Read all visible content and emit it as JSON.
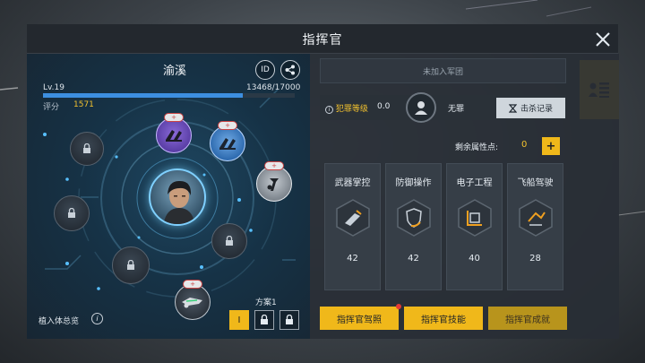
{
  "title": "指挥官",
  "commander": {
    "name": "渝溪",
    "id_label": "ID",
    "level": "Lv.19",
    "xp_text": "13468/17000",
    "xp_ratio": 0.792,
    "score_label": "评分",
    "score": "1571"
  },
  "implants": {
    "overview_label": "植入体总览",
    "info_label": "i",
    "plan_label": "方案1",
    "plan_buttons": [
      "I",
      "🔒",
      "🔒"
    ],
    "slots": [
      {
        "icon": "lock-icon",
        "state": "locked"
      },
      {
        "icon": "ship-parts-icon",
        "state": "purple",
        "badge": "+"
      },
      {
        "icon": "ship-parts-icon",
        "state": "blue",
        "badge": "+"
      },
      {
        "icon": "wrench-icon",
        "state": "gray",
        "badge": "+"
      },
      {
        "icon": "lock-icon",
        "state": "locked"
      },
      {
        "icon": "lock-icon",
        "state": "locked"
      },
      {
        "icon": "lock-icon",
        "state": "locked"
      },
      {
        "icon": "ship-icon",
        "state": "dark",
        "badge": "+"
      }
    ]
  },
  "legion": "未加入军团",
  "crime": {
    "label": "犯罪等级",
    "value": "0.0",
    "status": "无罪",
    "kill_record": "击杀记录"
  },
  "attributes": {
    "remain_label": "剩余属性点:",
    "remain_value": "0",
    "plus_label": "+"
  },
  "skills": [
    {
      "name": "武器掌控",
      "value": "42",
      "icon": "weapon-icon"
    },
    {
      "name": "防御操作",
      "value": "42",
      "icon": "shield-icon"
    },
    {
      "name": "电子工程",
      "value": "40",
      "icon": "electronics-icon"
    },
    {
      "name": "飞船驾驶",
      "value": "28",
      "icon": "pilot-icon"
    }
  ],
  "buttons": {
    "license": "指挥官驾照",
    "skill": "指挥官技能",
    "achievement": "指挥官成就"
  },
  "colors": {
    "accent": "#f0b81a",
    "xp": "#3d8fe0",
    "score": "#f2c12e"
  }
}
